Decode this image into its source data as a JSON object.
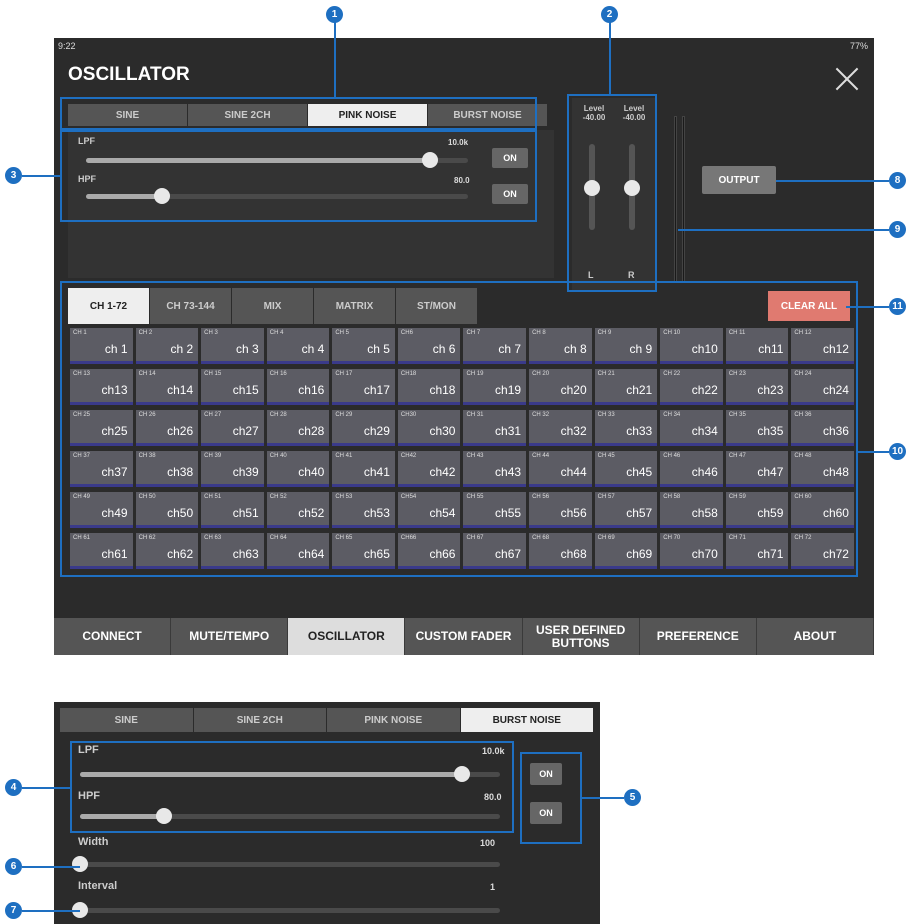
{
  "status": {
    "time": "9:22",
    "battery": "77%"
  },
  "title": "OSCILLATOR",
  "modes": [
    "SINE",
    "SINE 2CH",
    "PINK NOISE",
    "BURST NOISE"
  ],
  "filters": {
    "lpf": {
      "label": "LPF",
      "value": "10.0k",
      "on": "ON",
      "level": 0.9
    },
    "hpf": {
      "label": "HPF",
      "value": "80.0",
      "on": "ON",
      "level": 0.2
    }
  },
  "levels": {
    "l": {
      "caption": "Level",
      "value": "-40.00",
      "label": "L"
    },
    "r": {
      "caption": "Level",
      "value": "-40.00",
      "label": "R"
    }
  },
  "output_label": "OUTPUT",
  "channel_tabs": [
    "CH 1-72",
    "CH 73-144",
    "MIX",
    "MATRIX",
    "ST/MON"
  ],
  "clear_all": "CLEAR ALL",
  "channels": [
    {
      "s": "CH 1",
      "b": "ch 1"
    },
    {
      "s": "CH 2",
      "b": "ch 2"
    },
    {
      "s": "CH 3",
      "b": "ch 3"
    },
    {
      "s": "CH 4",
      "b": "ch 4"
    },
    {
      "s": "CH 5",
      "b": "ch 5"
    },
    {
      "s": "CH6",
      "b": "ch 6"
    },
    {
      "s": "CH 7",
      "b": "ch 7"
    },
    {
      "s": "CH 8",
      "b": "ch 8"
    },
    {
      "s": "CH 9",
      "b": "ch 9"
    },
    {
      "s": "CH 10",
      "b": "ch10"
    },
    {
      "s": "CH 11",
      "b": "ch11"
    },
    {
      "s": "CH 12",
      "b": "ch12"
    },
    {
      "s": "CH 13",
      "b": "ch13"
    },
    {
      "s": "CH 14",
      "b": "ch14"
    },
    {
      "s": "CH 15",
      "b": "ch15"
    },
    {
      "s": "CH 16",
      "b": "ch16"
    },
    {
      "s": "CH 17",
      "b": "ch17"
    },
    {
      "s": "CH18",
      "b": "ch18"
    },
    {
      "s": "CH 19",
      "b": "ch19"
    },
    {
      "s": "CH 20",
      "b": "ch20"
    },
    {
      "s": "CH 21",
      "b": "ch21"
    },
    {
      "s": "CH 22",
      "b": "ch22"
    },
    {
      "s": "CH 23",
      "b": "ch23"
    },
    {
      "s": "CH 24",
      "b": "ch24"
    },
    {
      "s": "CH 25",
      "b": "ch25"
    },
    {
      "s": "CH 26",
      "b": "ch26"
    },
    {
      "s": "CH 27",
      "b": "ch27"
    },
    {
      "s": "CH 28",
      "b": "ch28"
    },
    {
      "s": "CH 29",
      "b": "ch29"
    },
    {
      "s": "CH30",
      "b": "ch30"
    },
    {
      "s": "CH 31",
      "b": "ch31"
    },
    {
      "s": "CH 32",
      "b": "ch32"
    },
    {
      "s": "CH 33",
      "b": "ch33"
    },
    {
      "s": "CH 34",
      "b": "ch34"
    },
    {
      "s": "CH 35",
      "b": "ch35"
    },
    {
      "s": "CH 36",
      "b": "ch36"
    },
    {
      "s": "CH 37",
      "b": "ch37"
    },
    {
      "s": "CH 38",
      "b": "ch38"
    },
    {
      "s": "CH 39",
      "b": "ch39"
    },
    {
      "s": "CH 40",
      "b": "ch40"
    },
    {
      "s": "CH 41",
      "b": "ch41"
    },
    {
      "s": "CH42",
      "b": "ch42"
    },
    {
      "s": "CH 43",
      "b": "ch43"
    },
    {
      "s": "CH 44",
      "b": "ch44"
    },
    {
      "s": "CH 45",
      "b": "ch45"
    },
    {
      "s": "CH 46",
      "b": "ch46"
    },
    {
      "s": "CH 47",
      "b": "ch47"
    },
    {
      "s": "CH 48",
      "b": "ch48"
    },
    {
      "s": "CH 49",
      "b": "ch49"
    },
    {
      "s": "CH 50",
      "b": "ch50"
    },
    {
      "s": "CH 51",
      "b": "ch51"
    },
    {
      "s": "CH 52",
      "b": "ch52"
    },
    {
      "s": "CH 53",
      "b": "ch53"
    },
    {
      "s": "CH54",
      "b": "ch54"
    },
    {
      "s": "CH 55",
      "b": "ch55"
    },
    {
      "s": "CH 56",
      "b": "ch56"
    },
    {
      "s": "CH 57",
      "b": "ch57"
    },
    {
      "s": "CH 58",
      "b": "ch58"
    },
    {
      "s": "CH 59",
      "b": "ch59"
    },
    {
      "s": "CH 60",
      "b": "ch60"
    },
    {
      "s": "CH 61",
      "b": "ch61"
    },
    {
      "s": "CH 62",
      "b": "ch62"
    },
    {
      "s": "CH 63",
      "b": "ch63"
    },
    {
      "s": "CH 64",
      "b": "ch64"
    },
    {
      "s": "CH 65",
      "b": "ch65"
    },
    {
      "s": "CH66",
      "b": "ch66"
    },
    {
      "s": "CH 67",
      "b": "ch67"
    },
    {
      "s": "CH 68",
      "b": "ch68"
    },
    {
      "s": "CH 69",
      "b": "ch69"
    },
    {
      "s": "CH 70",
      "b": "ch70"
    },
    {
      "s": "CH 71",
      "b": "ch71"
    },
    {
      "s": "CH 72",
      "b": "ch72"
    }
  ],
  "tabs": {
    "connect": "CONNECT",
    "mute": "MUTE/TEMPO",
    "osc": "OSCILLATOR",
    "custom": "CUSTOM FADER",
    "user": "USER DEFINED BUTTONS",
    "pref": "PREFERENCE",
    "about": "ABOUT"
  },
  "burst": {
    "lpf": {
      "label": "LPF",
      "value": "10.0k",
      "on": "ON"
    },
    "hpf": {
      "label": "HPF",
      "value": "80.0",
      "on": "ON"
    },
    "width": {
      "label": "Width",
      "value": "100"
    },
    "interval": {
      "label": "Interval",
      "value": "1"
    }
  },
  "callouts": [
    "1",
    "2",
    "3",
    "4",
    "5",
    "6",
    "7",
    "8",
    "9",
    "10",
    "11"
  ],
  "colors": {
    "callout": "#1e6fc1",
    "clear_all": "#e07a70",
    "channel_strip": "#3a3a8a"
  }
}
